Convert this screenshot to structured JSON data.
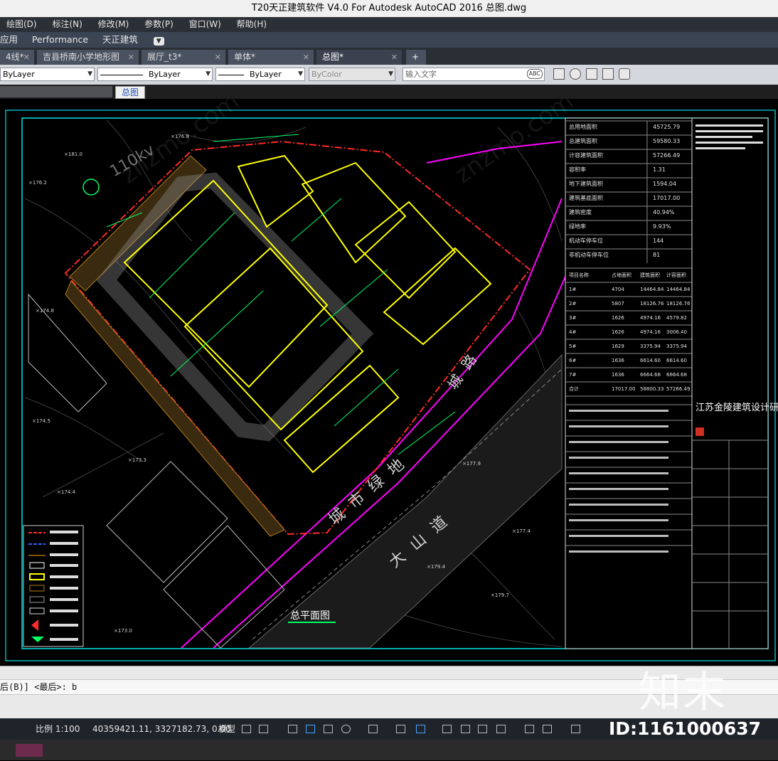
{
  "window": {
    "title": "T20天正建筑软件 V4.0 For Autodesk AutoCAD 2016    总图.dwg"
  },
  "menu": [
    "绘图(D)",
    "标注(N)",
    "修改(M)",
    "参数(P)",
    "窗口(W)",
    "帮助(H)"
  ],
  "ribbon": [
    "应用",
    "Performance",
    "天正建筑"
  ],
  "tabs": [
    "4线*",
    "吉县桥南小学地形图",
    "展厅_t3*",
    "单体*",
    "总图*"
  ],
  "properties": {
    "layer": "ByLayer",
    "linetype": "ByLayer",
    "lineweight": "ByLayer",
    "color": "ByColor",
    "search_placeholder": "输入文字"
  },
  "subtab": "总图",
  "drawing": {
    "plan_title": "总平面图",
    "road_1": "城市绿地",
    "road_2": "大山道",
    "road_3": "城路",
    "firm": "江苏金陵建筑设计研究院有限公司",
    "voltage_label": "110kv",
    "table_head": [
      "项目名称",
      "占地面积",
      "建筑面积",
      "计容面积"
    ],
    "table_rows": [
      [
        "1#",
        "4704",
        "14464.84",
        "14464.84"
      ],
      [
        "2#",
        "5807",
        "18126.76",
        "18126.76"
      ],
      [
        "3#",
        "1626",
        "4974.16",
        "4579.82"
      ],
      [
        "4#",
        "1626",
        "4974.16",
        "3006.40"
      ],
      [
        "5#",
        "1629",
        "3375.94",
        "3375.94"
      ],
      [
        "6#",
        "1636",
        "6614.60",
        "6614.60"
      ],
      [
        "7#",
        "1636",
        "6664.68",
        "6664.68"
      ],
      [
        "合计",
        "17017.00",
        "58800.33",
        "57266.49"
      ]
    ],
    "stats": [
      [
        "总用地面积",
        "45725.79"
      ],
      [
        "总建筑面积",
        "59580.33"
      ],
      [
        "计容建筑面积",
        "57266.49"
      ],
      [
        "容积率",
        "1.31"
      ],
      [
        "地下建筑面积",
        "1594.04"
      ],
      [
        "建筑基底面积",
        "17017.00"
      ],
      [
        "建筑密度",
        "40.94%"
      ],
      [
        "绿地率",
        "9.93%"
      ],
      [
        "机动车停车位",
        "144"
      ],
      [
        "非机动车停车位",
        "81"
      ]
    ]
  },
  "command": {
    "text": "后(B)] <最后>: b"
  },
  "status": {
    "scale": "比例 1:100",
    "coords": "40359421.11, 3327182.73, 0.00",
    "space": "模型"
  },
  "watermark": {
    "brand": "知末",
    "id": "ID:1161000637"
  },
  "colors": {
    "canvas": "#000000",
    "frame": "#00ffff",
    "road": "#ff00ff",
    "building": "#ffff00",
    "redline": "#ff2020"
  }
}
